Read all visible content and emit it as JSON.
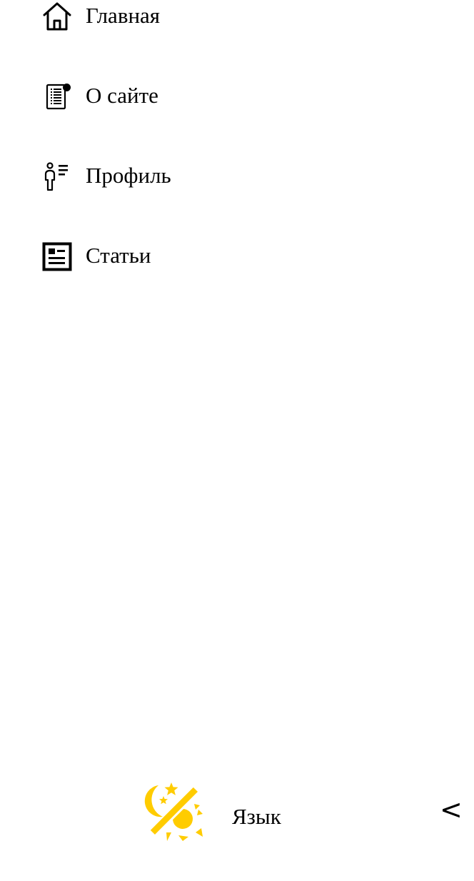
{
  "sidebar": {
    "items": [
      {
        "label": "Главная",
        "icon": "home-icon"
      },
      {
        "label": "О сайте",
        "icon": "document-info-icon"
      },
      {
        "label": "Профиль",
        "icon": "profile-icon"
      },
      {
        "label": "Статьи",
        "icon": "articles-icon"
      }
    ]
  },
  "footer": {
    "language_label": "Язык",
    "collapse_glyph": "<",
    "theme_icon": "day-night-toggle-icon",
    "accent_color": "#FFCC00"
  }
}
